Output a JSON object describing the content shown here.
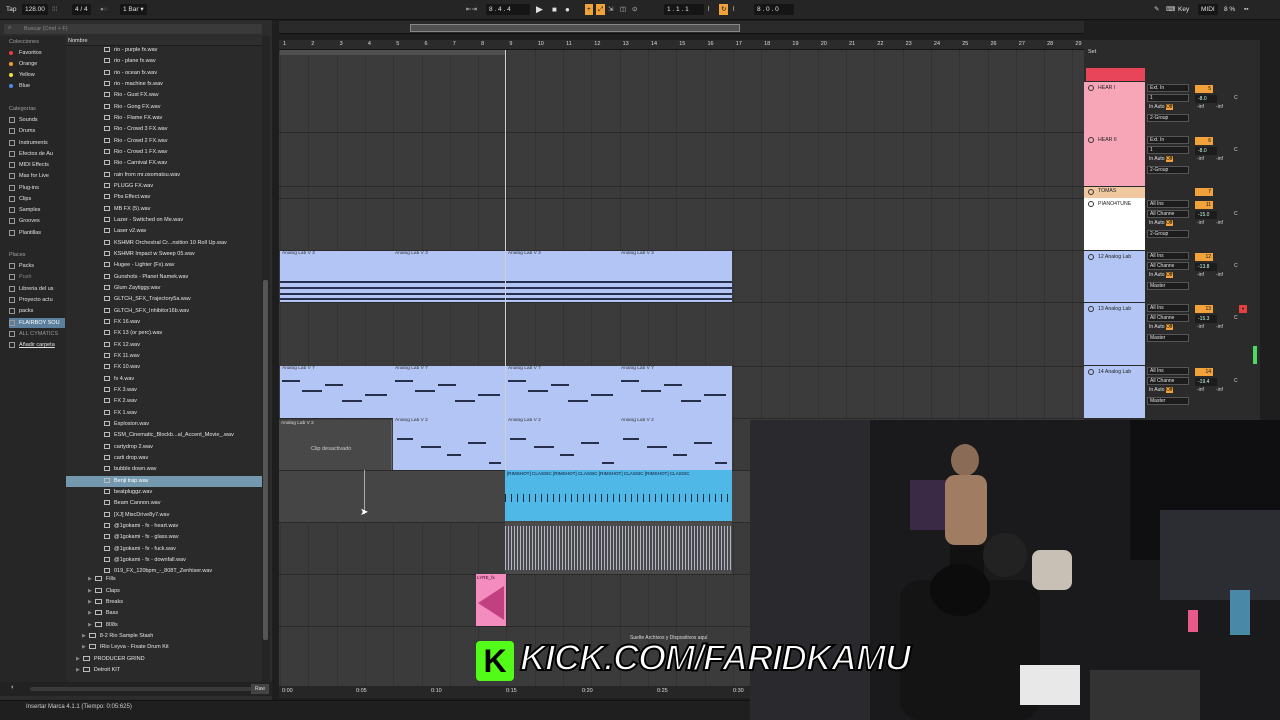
{
  "transport": {
    "tap": "Tap",
    "tempo": "128.00",
    "signature": "4 / 4",
    "rate": "1 Bar",
    "position": "8 .  4 .  4",
    "loop_start": "1 .   1 .   1",
    "loop_len": "8 .   0 .   0",
    "key": "Key",
    "midi": "MIDI",
    "cpu": "8 %"
  },
  "browser": {
    "search_placeholder": "Buscar (Cmd + F)",
    "column_header": "Nombre",
    "collections_header": "Colecciones",
    "collections": [
      {
        "label": "Favoritos",
        "color": "#e84040"
      },
      {
        "label": "Orange",
        "color": "#f0a030"
      },
      {
        "label": "Yellow",
        "color": "#f0e040"
      },
      {
        "label": "Blue",
        "color": "#4a8cf0"
      }
    ],
    "categories_header": "Categorías",
    "categories": [
      "Sounds",
      "Drums",
      "Instruments",
      "Efectos de Au",
      "MIDI Effects",
      "Max for Live",
      "Plug-ins",
      "Clips",
      "Samples",
      "Grooves",
      "Plantillas"
    ],
    "places_header": "Places",
    "places": [
      "Packs",
      "Push",
      "Libreria del us",
      "Proyecto actu",
      "packs",
      "FLAIRBOY SOU",
      "ALL CYMATICS",
      "Añadir carpeta"
    ],
    "files": [
      "rio - purple fx.wav",
      "rio - plane fx.wav",
      "rio - ocean fx.wav",
      "rio - machine fx.wav",
      "Rio - Gust FX.wav",
      "Rio - Gong FX.wav",
      "Rio - Flame FX.wav",
      "Rio - Crowd 3 FX.wav",
      "Rio - Crowd 2 FX.wav",
      "Rio - Crowd 1 FX.wav",
      "Rio - Carnival FX.wav",
      "rain from mr.osomatsu.wav",
      "PLUGG FX.wav",
      "Pbs Effect.wav",
      "MB FX (5).wav",
      "Lazer - Switched on Me.wav",
      "Laser v2.wav",
      "KSHMR  Orchestral  Cr...nsition  10  Roll  Up.wav",
      "KSHMR  Impact  w  Sweep  05.wav",
      "Hugee - Lighter (Fx).wav",
      "Gunshots - Planet Namek.wav",
      "Glum Zaytiggy.wav",
      "GLTCH_SFX_Trajectory5a.wav",
      "GLTCH_SFX_Inhibitor16b.wav",
      "FX 16.wav",
      "FX 13 (or perc).wav",
      "FX 12.wav",
      "FX 11.wav",
      "FX 10.wav",
      "fx 4.wav",
      "FX 3.wav",
      "FX 2.wav",
      "FX 1.wav",
      "Explosion.wav",
      "ESM_Cinematic_Blockb...al_Accent_Movie_.wav",
      "cartydrop 2.wav",
      "carti drop.wav",
      "bubble down.wav",
      "Benji trap.wav",
      "beatpluggz.wav",
      "Beam Cannon.wav",
      "[XJ] MiscDrive8y7.wav",
      "@1gokami - fx - heart.wav",
      "@1gokami - fx - glass.wav",
      "@1gokami - fx - fuck.wav",
      "@1gokami - fx - downfall.wav",
      "019_FX_120bpm_-_808T_Zenhiser.wav"
    ],
    "selected_file": "Benji trap.wav",
    "subfolders": [
      "Fills",
      "Claps",
      "Breaks",
      "Bass",
      "808s"
    ],
    "packs": [
      "8-2 Rio Sample Stash",
      "IRio Leyva - Fixate Drum Kit",
      "PRODUCER GRIND",
      "Detroit KIT"
    ],
    "raw_label": "Raw"
  },
  "arrangement": {
    "ruler": [
      "1",
      "2",
      "3",
      "4",
      "5",
      "6",
      "7",
      "8",
      "9",
      "10",
      "11",
      "12",
      "13",
      "14",
      "15",
      "16",
      "17",
      "18",
      "19",
      "20",
      "21",
      "22",
      "23",
      "24",
      "25",
      "26",
      "27",
      "28",
      "29"
    ],
    "time_labels": [
      "0:00",
      "0:05",
      "0:10",
      "0:15",
      "0:20",
      "0:25",
      "0:30"
    ],
    "clip_names": {
      "analog3": "Analog Lab V 3",
      "analog7": "Analog Lab V 7",
      "analog2": "Analog Lab V 2",
      "deactivated": "Clip desactivado",
      "rimshot": "[RIMSHOT] CLASSIC",
      "lyre": "LYRE_fx"
    },
    "drop_message": "Suelte Archivos y Dispositivos aquí"
  },
  "mixer": {
    "set_label": "Set",
    "tracks": [
      {
        "name": "HEAR I",
        "color": "#f7a6b8",
        "input": "Ext. In",
        "ch": "1",
        "mon": "Auto",
        "out": "2-Group",
        "num": "5",
        "vol": "-8.0",
        "pan": "C",
        "peak": "-inf"
      },
      {
        "name": "HEAR II",
        "color": "#f7a6b8",
        "input": "Ext. In",
        "ch": "1",
        "mon": "Auto",
        "out": "2-Group",
        "num": "6",
        "vol": "-8.0",
        "pan": "C",
        "peak": "-inf"
      },
      {
        "name": "TOMAS",
        "color": "#f0c8a0",
        "num": "7"
      },
      {
        "name": "PIANO4TUNE",
        "color": "#ffffff",
        "input": "All Ins",
        "ch": "All Channe",
        "mon": "Auto",
        "out": "2-Group",
        "num": "11",
        "vol": "-15.0",
        "pan": "C",
        "peak": "-inf"
      },
      {
        "name": "12 Analog Lab",
        "color": "#b3c5f4",
        "input": "All Ins",
        "ch": "All Channe",
        "mon": "Auto",
        "out": "Master",
        "num": "12",
        "vol": "-13.8",
        "pan": "C",
        "peak": "-inf"
      },
      {
        "name": "13 Analog Lab",
        "color": "#b3c5f4",
        "input": "All Ins",
        "ch": "All Channe",
        "mon": "Auto",
        "out": "Master",
        "num": "13",
        "vol": "-15.3",
        "pan": "C",
        "peak": "-inf"
      },
      {
        "name": "14 Analog Lab",
        "color": "#b3c5f4",
        "input": "All Ins",
        "ch": "All Channe",
        "mon": "Auto",
        "out": "Master",
        "num": "14",
        "vol": "-19.4",
        "pan": "C",
        "peak": "-inf"
      }
    ],
    "off_label": "Off",
    "in_label": "In"
  },
  "status": "Insertar Marca 4.1.1 (Tiempo: 0:05:625)",
  "overlay": {
    "brand": "KICK.COM/FARIDKAMU",
    "brand_letter": "K"
  }
}
